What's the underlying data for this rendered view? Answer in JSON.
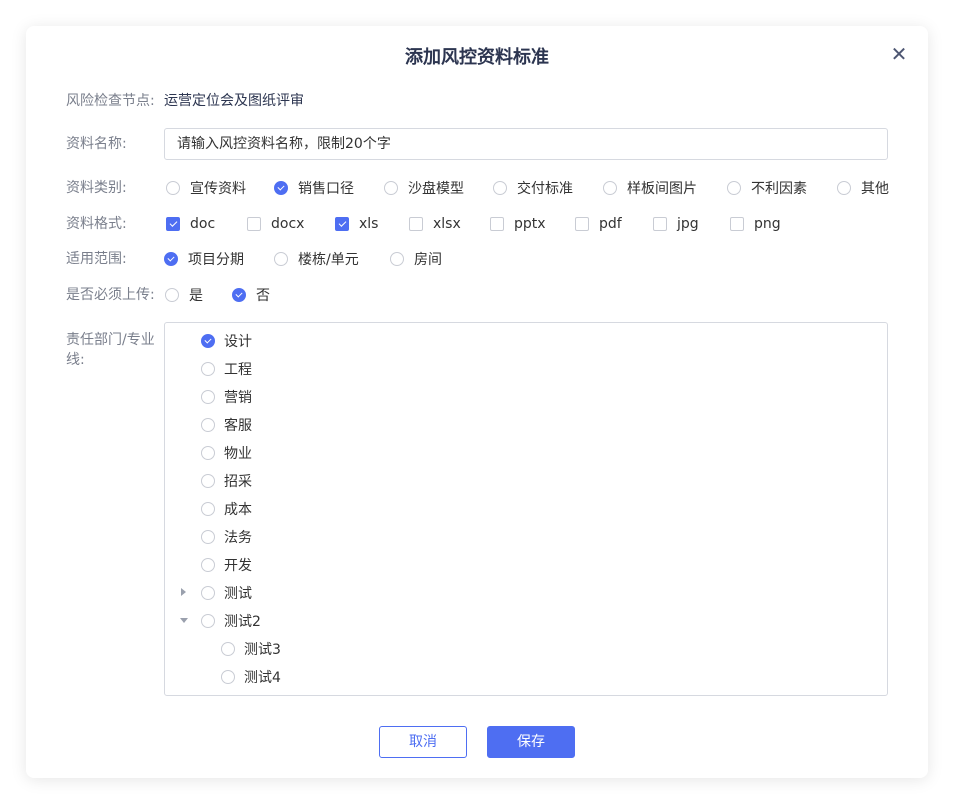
{
  "dialog": {
    "title": "添加风控资料标准",
    "close_icon": "close-icon"
  },
  "fields": {
    "risk_node": {
      "label": "风险检查节点:",
      "value": "运营定位会及图纸评审"
    },
    "doc_name": {
      "label": "资料名称:",
      "value": "",
      "placeholder": "请输入风控资料名称，限制20个字"
    },
    "doc_type": {
      "label": "资料类别:",
      "options": [
        {
          "label": "宣传资料",
          "selected": false
        },
        {
          "label": "销售口径",
          "selected": true
        },
        {
          "label": "沙盘模型",
          "selected": false
        },
        {
          "label": "交付标准",
          "selected": false
        },
        {
          "label": "样板间图片",
          "selected": false
        },
        {
          "label": "不利因素",
          "selected": false
        },
        {
          "label": "其他",
          "selected": false
        }
      ]
    },
    "doc_format": {
      "label": "资料格式:",
      "options": [
        {
          "label": "doc",
          "checked": true
        },
        {
          "label": "docx",
          "checked": false
        },
        {
          "label": "xls",
          "checked": true
        },
        {
          "label": "xlsx",
          "checked": false
        },
        {
          "label": "pptx",
          "checked": false
        },
        {
          "label": "pdf",
          "checked": false
        },
        {
          "label": "jpg",
          "checked": false
        },
        {
          "label": "png",
          "checked": false
        }
      ]
    },
    "scope": {
      "label": "适用范围:",
      "options": [
        {
          "label": "项目分期",
          "selected": true
        },
        {
          "label": "楼栋/单元",
          "selected": false
        },
        {
          "label": "房间",
          "selected": false
        }
      ]
    },
    "required": {
      "label": "是否必须上传:",
      "options": [
        {
          "label": "是",
          "selected": false
        },
        {
          "label": "否",
          "selected": true
        }
      ]
    },
    "department": {
      "label": "责任部门/专业线:",
      "tree": [
        {
          "label": "设计",
          "selected": true
        },
        {
          "label": "工程",
          "selected": false
        },
        {
          "label": "营销",
          "selected": false
        },
        {
          "label": "客服",
          "selected": false
        },
        {
          "label": "物业",
          "selected": false
        },
        {
          "label": "招采",
          "selected": false
        },
        {
          "label": "成本",
          "selected": false
        },
        {
          "label": "法务",
          "selected": false
        },
        {
          "label": "开发",
          "selected": false
        },
        {
          "label": "测试",
          "selected": false,
          "expandable": true,
          "expanded": false
        },
        {
          "label": "测试2",
          "selected": false,
          "expandable": true,
          "expanded": true,
          "children": [
            {
              "label": "测试3",
              "selected": false
            },
            {
              "label": "测试4",
              "selected": false
            }
          ]
        }
      ]
    }
  },
  "buttons": {
    "cancel": "取消",
    "save": "保存"
  },
  "colors": {
    "accent": "#4e6ef2",
    "title": "#2c3550",
    "label": "#7a7f8c",
    "border": "#d6d9e0"
  }
}
